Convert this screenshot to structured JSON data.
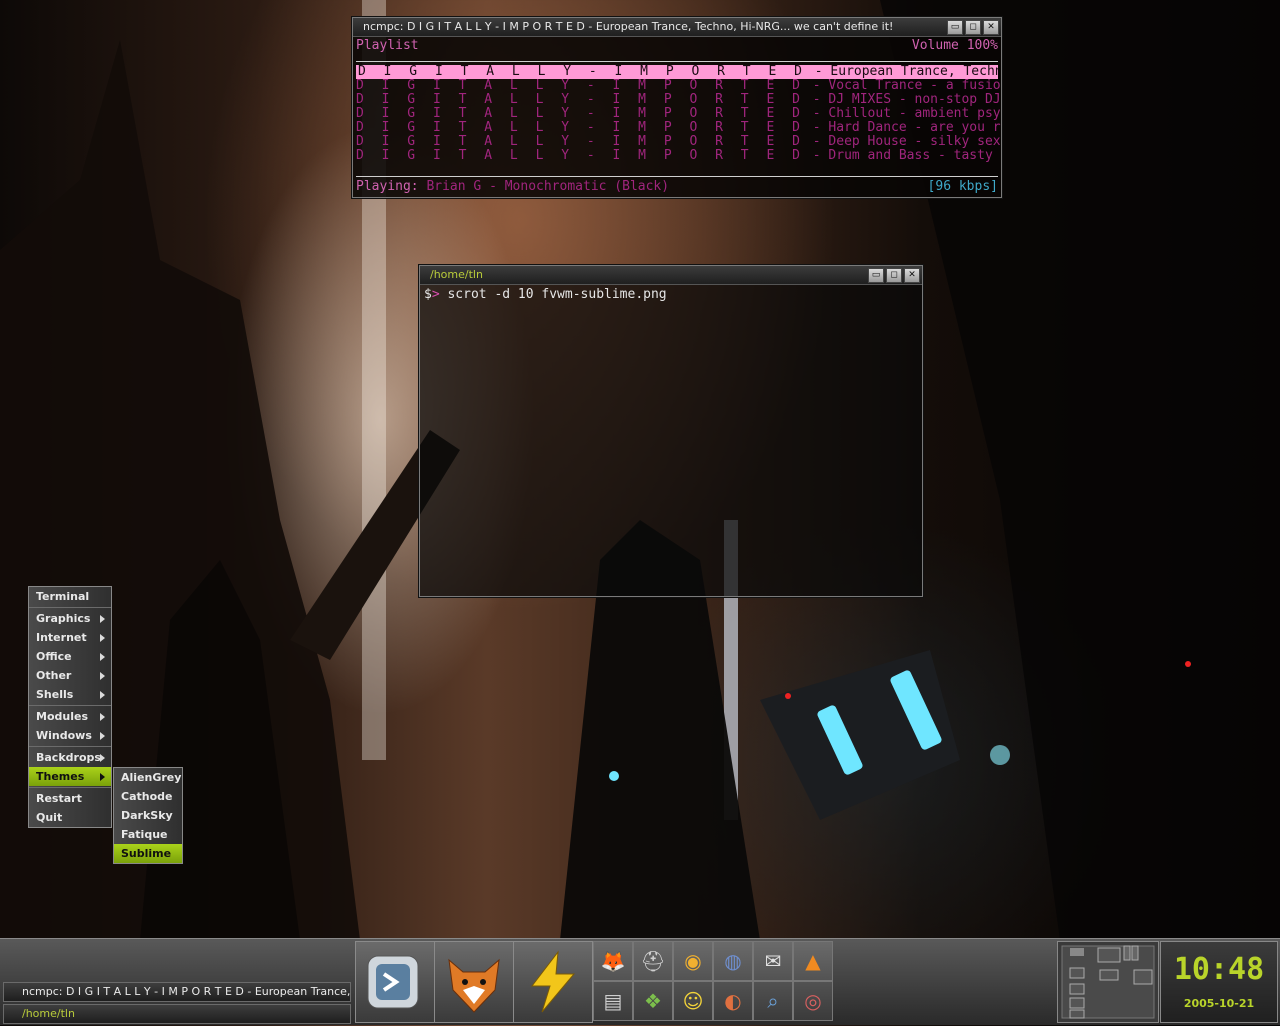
{
  "ncmpc": {
    "title": "ncmpc: D I G I T A L L Y - I M P O R T E D - European Trance, Techno, Hi-NRG... we can't define it!",
    "header_left": "Playlist",
    "header_right": "Volume 100%",
    "rows": [
      {
        "station": "D I G I T A L L Y - I M P O R T E D",
        "rest": " - European Trance, Techno, Hi-NRG... we can’"
      },
      {
        "station": "D I G I T A L L Y - I M P O R T E D",
        "rest": " - Vocal Trance - a fusion of trance, dance, "
      },
      {
        "station": "D I G I T A L L Y - I M P O R T E D",
        "rest": " - DJ MIXES - non-stop DJ sets featuring vari"
      },
      {
        "station": "D I G I T A L L Y - I M P O R T E D",
        "rest": " - Chillout - ambient psy chillout, check out"
      },
      {
        "station": "D I G I T A L L Y - I M P O R T E D",
        "rest": " - Hard Dance - are you ready for this!"
      },
      {
        "station": "D I G I T A L L Y - I M P O R T E D",
        "rest": " - Deep House - silky sexy deep house music d"
      },
      {
        "station": "D I G I T A L L Y - I M P O R T E D",
        "rest": " - Drum and Bass - tasty assortment to satisf"
      }
    ],
    "playing_label": "Playing:",
    "playing_track": "Brian G - Monochromatic (Black)",
    "bitrate": "[96 kbps]"
  },
  "terminal": {
    "title": "/home/tln",
    "prompt_1": "$",
    "prompt_2": ">",
    "command": "scrot -d 10 fvwm-sublime.png"
  },
  "window_buttons": {
    "minimize": "▭",
    "maximize": "◻",
    "close": "✕"
  },
  "menu": {
    "items": [
      {
        "label": "Terminal",
        "sub": false
      },
      {
        "label": "Graphics",
        "sub": true
      },
      {
        "label": "Internet",
        "sub": true
      },
      {
        "label": "Office",
        "sub": true
      },
      {
        "label": "Other",
        "sub": true
      },
      {
        "label": "Shells",
        "sub": true
      },
      {
        "label": "Modules",
        "sub": true
      },
      {
        "label": "Windows",
        "sub": true
      },
      {
        "label": "Backdrops",
        "sub": true
      },
      {
        "label": "Themes",
        "sub": true
      },
      {
        "label": "Restart",
        "sub": false
      },
      {
        "label": "Quit",
        "sub": false
      }
    ],
    "themes": [
      "AlienGrey",
      "Cathode",
      "DarkSky",
      "Fatique",
      "Sublime"
    ]
  },
  "panel": {
    "tasks": [
      "ncmpc: D I G I T A L L Y - I M P O R T E D - European Trance,",
      "/home/tln"
    ],
    "launchers": [
      "terminal-launcher-icon",
      "firefox-icon",
      "lightning-icon"
    ],
    "tray_icons": [
      "gimp-icon",
      "scanner-icon",
      "media-icon",
      "globe-icon",
      "mail-icon",
      "vlc-icon",
      "notes-icon",
      "files-icon",
      "face-icon",
      "audio-icon",
      "search-icon",
      "cd-icon"
    ],
    "clock_time": "10:48",
    "clock_date": "2005-10-21"
  },
  "colors": {
    "accent": "#aad21a",
    "pink": "#d062b0",
    "cyan": "#3fa9c9"
  }
}
